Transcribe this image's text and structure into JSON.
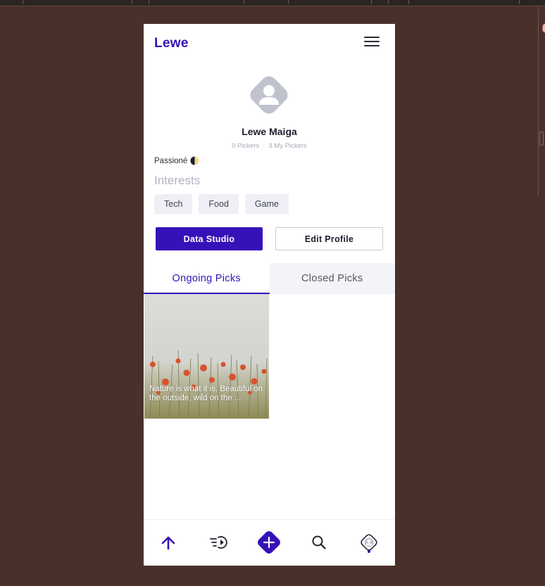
{
  "app": {
    "brand": "Lewe"
  },
  "profile": {
    "name": "Lewe Maiga",
    "pickers": "0 Pickers",
    "separator": "·",
    "my_pickers": "3 My Pickers",
    "mood": "Passioné",
    "interests_title": "Interests",
    "interests": [
      "Tech",
      "Food",
      "Game"
    ]
  },
  "actions": {
    "data_studio": "Data Studio",
    "edit_profile": "Edit Profile"
  },
  "tabs": [
    {
      "label": "Ongoing Picks",
      "active": true
    },
    {
      "label": "Closed Picks",
      "active": false
    }
  ],
  "picks": [
    {
      "caption": "Nature is what it is. Beautiful on the outside, wild on the ..."
    }
  ],
  "bottom_nav": [
    {
      "icon": "arrow-up-icon"
    },
    {
      "icon": "play-list-icon"
    },
    {
      "icon": "add-icon"
    },
    {
      "icon": "search-icon"
    },
    {
      "icon": "profile-icon",
      "active": true
    }
  ],
  "colors": {
    "accent": "#3512b8",
    "background": "#4a302a",
    "muted": "#b3b3c3"
  }
}
